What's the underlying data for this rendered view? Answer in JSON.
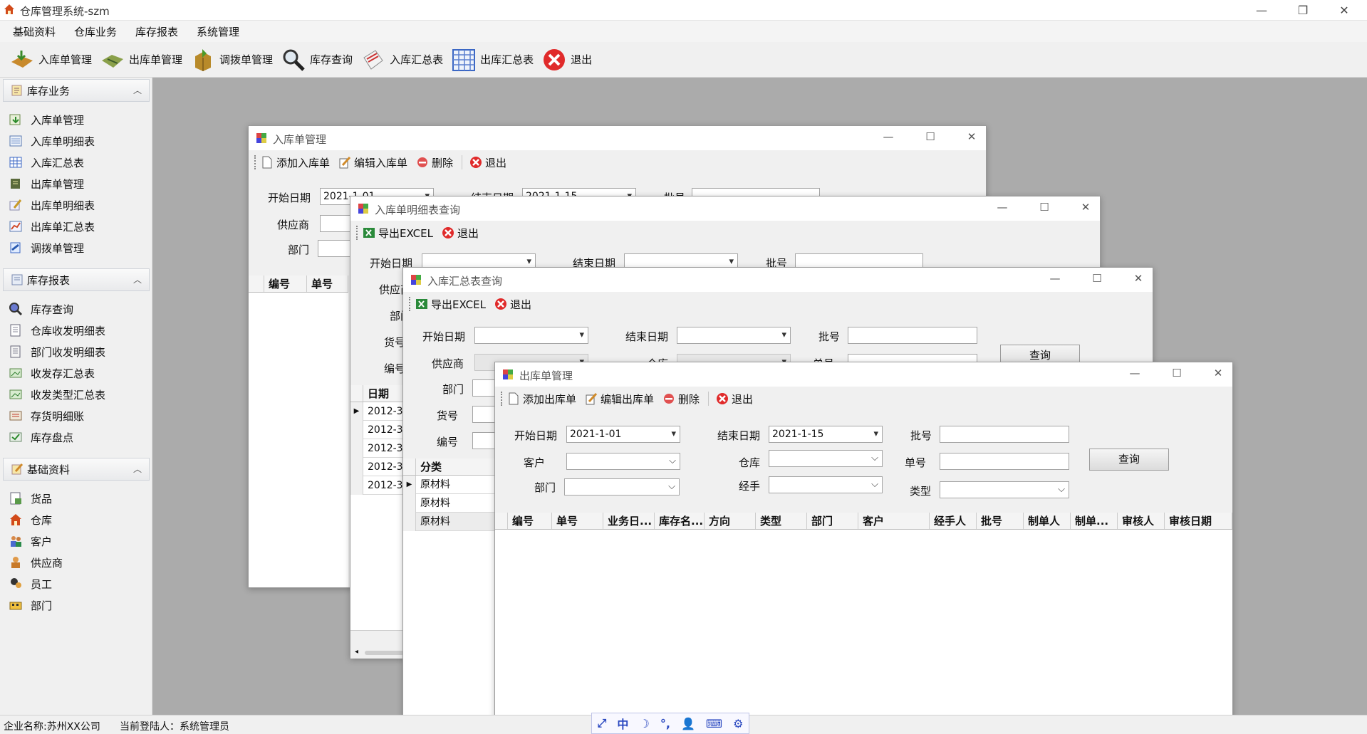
{
  "app": {
    "title": "仓库管理系统-szm"
  },
  "menu": [
    "基础资料",
    "仓库业务",
    "库存报表",
    "系统管理"
  ],
  "toolbar": [
    {
      "label": "入库单管理",
      "icon": "stock-in-icon"
    },
    {
      "label": "出库单管理",
      "icon": "stock-out-icon"
    },
    {
      "label": "调拨单管理",
      "icon": "transfer-icon"
    },
    {
      "label": "库存查询",
      "icon": "magnifier-icon"
    },
    {
      "label": "入库汇总表",
      "icon": "summary-icon"
    },
    {
      "label": "出库汇总表",
      "icon": "table-icon"
    },
    {
      "label": "退出",
      "icon": "exit-icon"
    }
  ],
  "sidebar": {
    "groups": [
      {
        "title": "库存业务",
        "items": [
          "入库单管理",
          "入库单明细表",
          "入库汇总表",
          "出库单管理",
          "出库单明细表",
          "出库单汇总表",
          "调拨单管理"
        ]
      },
      {
        "title": "库存报表",
        "items": [
          "库存查询",
          "仓库收发明细表",
          "部门收发明细表",
          "收发存汇总表",
          "收发类型汇总表",
          "存货明细账",
          "库存盘点"
        ]
      },
      {
        "title": "基础资料",
        "items": [
          "货品",
          "仓库",
          "客户",
          "供应商",
          "员工",
          "部门"
        ]
      }
    ]
  },
  "status": {
    "company": "企业名称:苏州XX公司",
    "user": "当前登陆人：系统管理员"
  },
  "win1": {
    "title": "入库单管理",
    "tools": [
      "添加入库单",
      "编辑入库单",
      "删除",
      "退出"
    ],
    "start_label": "开始日期",
    "start_value": "2021-1-01",
    "end_label": "结束日期",
    "end_value": "2021-1-15",
    "batch_label": "批号",
    "supplier_label": "供应商",
    "dept_label": "部门",
    "cols": [
      "编号",
      "单号"
    ]
  },
  "win2": {
    "title": "入库单明细表查询",
    "tools": [
      "导出EXCEL",
      "退出"
    ],
    "start_label": "开始日期",
    "end_label": "结束日期",
    "batch_label": "批号",
    "supplier_label": "供应商",
    "dept_label": "部门",
    "goods_label": "货号",
    "code_label": "编号",
    "date_col": "日期",
    "rows": [
      "2012-3-",
      "2012-3-",
      "2012-3-",
      "2012-3-",
      "2012-3-"
    ]
  },
  "win3": {
    "title": "入库汇总表查询",
    "tools": [
      "导出EXCEL",
      "退出"
    ],
    "start_label": "开始日期",
    "end_label": "结束日期",
    "batch_label": "批号",
    "supplier_label": "供应商",
    "warehouse_label": "仓库",
    "order_label": "单号",
    "dept_label": "部门",
    "goods_label": "货号",
    "code_label": "编号",
    "query": "查询",
    "cat_col": "分类",
    "rows": [
      "原材料",
      "原材料",
      "原材料"
    ]
  },
  "win4": {
    "title": "出库单管理",
    "tools": [
      "添加出库单",
      "编辑出库单",
      "删除",
      "退出"
    ],
    "start_label": "开始日期",
    "start_value": "2021-1-01",
    "end_label": "结束日期",
    "end_value": "2021-1-15",
    "batch_label": "批号",
    "customer_label": "客户",
    "warehouse_label": "仓库",
    "order_label": "单号",
    "dept_label": "部门",
    "handler_label": "经手",
    "type_label": "类型",
    "query": "查询",
    "cols": [
      "编号",
      "单号",
      "业务日...",
      "库存名...",
      "方向",
      "类型",
      "部门",
      "客户",
      "经手人",
      "批号",
      "制单人",
      "制单...",
      "审核人",
      "审核日期"
    ]
  },
  "ime": [
    "⤢",
    "中",
    "☽",
    "°,",
    "👤",
    "⌨",
    "⚙"
  ]
}
